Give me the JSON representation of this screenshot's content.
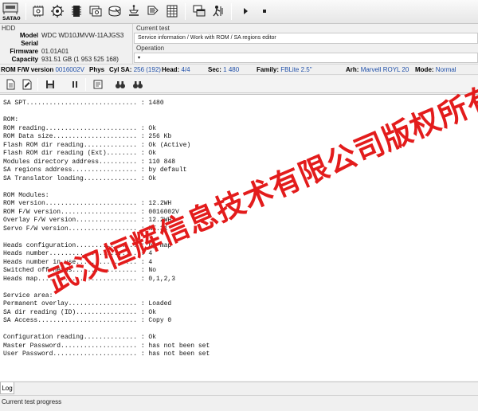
{
  "toolbar": {
    "sata_label": "SATA0",
    "icons": [
      "sata-port",
      "chip",
      "settings-gear",
      "memory-module",
      "copy-drive",
      "disk",
      "tester",
      "head-stack",
      "grid-table",
      "windows-stack",
      "terminal-user",
      "play",
      "stop"
    ]
  },
  "hdd": {
    "title": "HDD",
    "model_label": "Model",
    "model_value": "WDC WD10JMVW-11AJGS3",
    "serial_label": "Serial",
    "serial_value": "",
    "firmware_label": "Firmware",
    "firmware_value": "01.01A01",
    "capacity_label": "Capacity",
    "capacity_value": "931.51 GB (1 953 525 168)"
  },
  "current_test": {
    "title": "Current test",
    "text": "Service information / Work with ROM / SA regions editor",
    "operation_title": "Operation",
    "operation_value": ""
  },
  "fw_line": {
    "rom_fw_label": "ROM F/W version",
    "rom_fw_value": "0016002V",
    "phys_label": "Phys",
    "cyl_sa_label": "Cyl SA:",
    "cyl_sa_value": "256 (192)",
    "head_label": "Head:",
    "head_value": "4/4",
    "sec_label": "Sec:",
    "sec_value": "1 480",
    "family_label": "Family:",
    "family_value": "FBLite 2.5\"",
    "arh_label": "Arh:",
    "arh_value": "Marvell ROYL 20",
    "mode_label": "Mode:",
    "mode_value": "Normal"
  },
  "log": {
    "lines": [
      "SA SPT............................. : 1480",
      "",
      "ROM:",
      "ROM reading........................ : Ok",
      "ROM Data size...................... : 256 Kb",
      "Flash ROM dir reading.............. : Ok (Active)",
      "Flash ROM dir reading (Ext)........ : Ok",
      "Modules directory address.......... : 110 848",
      "SA regions address................. : by default",
      "SA Translator loading.............. : Ok",
      "",
      "ROM Modules:",
      "ROM version........................ : 12.2WH",
      "ROM F/W version.................... : 0016002V",
      "Overlay F/W version................ : 12.2WH",
      "Servo F/W version.................. : NE.31",
      "",
      "Heads configuration................ : by map",
      "Heads number....................... : 4",
      "Heads number in use................ : 4",
      "Switched off heads................. : No",
      "Heads map.......................... : 0,1,2,3",
      "",
      "Service area:",
      "Permanent overlay.................. : Loaded",
      "SA dir reading (ID)................ : Ok",
      "SA Access.......................... : Copy 0",
      "",
      "Configuration reading.............. : Ok",
      "Master Password.................... : has not been set",
      "User Password...................... : has not been set"
    ]
  },
  "watermark": "武汉恒辉信息技术有限公司版权所有",
  "bottom": {
    "log_tab": "Log",
    "status_text": "Current test progress"
  },
  "colors": {
    "accent_blue": "#1f4fa8",
    "watermark_red": "#e31c1c"
  }
}
